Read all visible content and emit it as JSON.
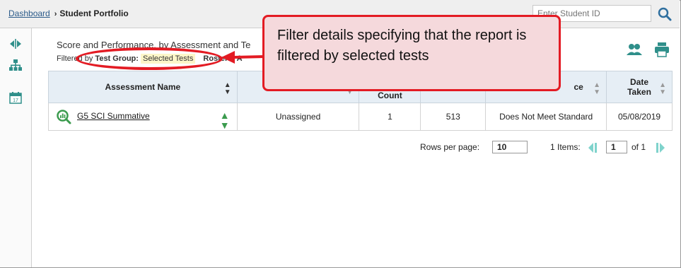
{
  "breadcrumb": {
    "home": "Dashboard",
    "separator": "›",
    "current": "Student Portfolio"
  },
  "search": {
    "placeholder": "Enter Student ID"
  },
  "report": {
    "title": "Score and Performance, by Assessment and Te",
    "filtered_by_label": "Filtered by",
    "test_group_label": "Test Group:",
    "test_group_value": "Selected Tests",
    "rosters_label": "Rosters: A"
  },
  "table": {
    "headers": {
      "assessment_name": "Assessment Name",
      "count": "Count",
      "performance": "ce",
      "date_taken_line1": "Date",
      "date_taken_line2": "Taken"
    },
    "rows": [
      {
        "name": "G5 SCI Summative",
        "assigned": "Unassigned",
        "count": "1",
        "score": "513",
        "performance": "Does Not Meet Standard",
        "date": "05/08/2019"
      }
    ]
  },
  "pagination": {
    "rows_per_page_label": "Rows per page:",
    "rows_per_page": "10",
    "items": "1 Items:",
    "page": "1",
    "of": "of 1"
  },
  "callout": {
    "text": "Filter details specifying that the report is filtered by selected tests"
  },
  "colors": {
    "accent_red": "#e31b23",
    "callout_bg": "#f5d9dc",
    "header_bg": "#e6eef5",
    "icon_green": "#3b9b4e",
    "nav_teal": "#2f8f8a"
  }
}
